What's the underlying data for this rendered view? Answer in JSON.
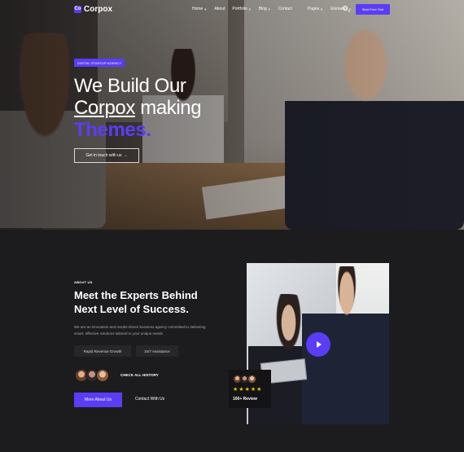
{
  "brand": {
    "logo_mark": "Co",
    "name": "Corpox"
  },
  "nav": {
    "items": [
      {
        "label": "Home",
        "dropdown": true
      },
      {
        "label": "About",
        "dropdown": false
      },
      {
        "label": "Portfolio",
        "dropdown": true
      },
      {
        "label": "Blog",
        "dropdown": true
      },
      {
        "label": "Contact",
        "dropdown": false
      },
      {
        "label": "Pages",
        "dropdown": true
      },
      {
        "label": "Elements",
        "dropdown": true
      }
    ],
    "search_icon": "search-icon",
    "cta": "Start Free Trial"
  },
  "hero": {
    "badge": "DIGITAL STARTUP AGENCY",
    "line1": "We Build Our",
    "line2_brand": "Corpox",
    "line2_rest": " making",
    "line3": "Themes.",
    "cta": "Get in touch with us",
    "cta_icon": "arrow-right-icon"
  },
  "about": {
    "eyebrow": "ABOUT US",
    "title_line1": "Meet the Experts Behind",
    "title_line2": "Next Level of Success.",
    "description": "We are an innovative and results-driven business agency committed to delivering smart, effective solutions tailored to your unique needs.",
    "tags": [
      "Rapid Revenue Growth",
      "24/7 Assistance"
    ],
    "history_link": "CHECK ALL HISTORY",
    "primary_button": "More About Us",
    "secondary_button": "Contact With Us",
    "review": {
      "stars": 5,
      "label": "100+ Review"
    }
  },
  "colors": {
    "accent": "#5b3df5",
    "background": "#1c1c1f",
    "star": "#f5b700"
  }
}
